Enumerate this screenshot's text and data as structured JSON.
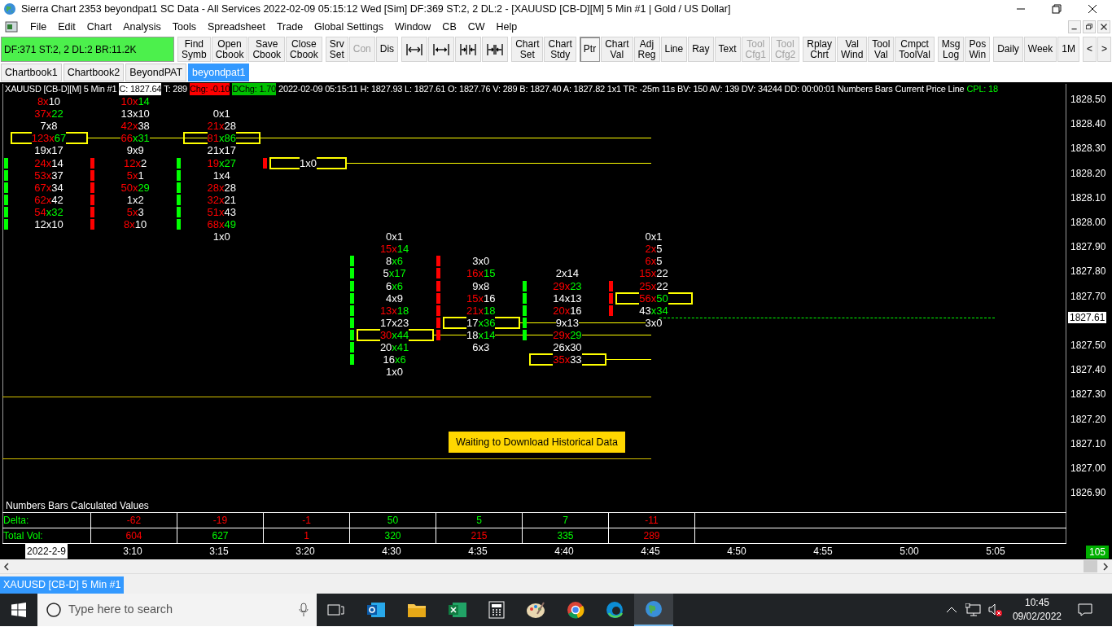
{
  "window": {
    "title": "Sierra Chart 2353 beyondpat1  SC Data - All Services 2022-02-09  05:15:12 Wed [Sim]  DF:369  ST:2, 2  DL:2 - [XAUUSD [CB-D][M]  5 Min   #1 | Gold / US Dollar]"
  },
  "menu": [
    "File",
    "Edit",
    "Chart",
    "Analysis",
    "Tools",
    "Spreadsheet",
    "Trade",
    "Global Settings",
    "Window",
    "CB",
    "CW",
    "Help"
  ],
  "status_box": "DF:371  ST:2, 2  DL:2  BR:11.2K",
  "toolbar": [
    [
      {
        "kind": "text",
        "lines": [
          "Find",
          "Symb"
        ],
        "disabled": false,
        "selected": false
      },
      {
        "kind": "text",
        "lines": [
          "Open",
          "Cbook"
        ],
        "disabled": false,
        "selected": false
      },
      {
        "kind": "text",
        "lines": [
          "Save",
          "Cbook"
        ],
        "disabled": false,
        "selected": false
      },
      {
        "kind": "text",
        "lines": [
          "Close",
          "Cbook"
        ],
        "disabled": false,
        "selected": false
      }
    ],
    [
      {
        "kind": "text",
        "lines": [
          "Srv",
          "Set"
        ],
        "disabled": false,
        "selected": false
      },
      {
        "kind": "text",
        "lines": [
          "Con"
        ],
        "disabled": true,
        "selected": false
      },
      {
        "kind": "text",
        "lines": [
          "Dis"
        ],
        "disabled": false,
        "selected": false
      }
    ],
    [
      {
        "kind": "icon",
        "disabled": false,
        "selected": false
      },
      {
        "kind": "icon",
        "disabled": false,
        "selected": false
      },
      {
        "kind": "icon",
        "disabled": false,
        "selected": false
      },
      {
        "kind": "icon",
        "disabled": false,
        "selected": false
      }
    ],
    [
      {
        "kind": "text",
        "lines": [
          "Chart",
          "Set"
        ],
        "disabled": false,
        "selected": false
      },
      {
        "kind": "text",
        "lines": [
          "Chart",
          "Stdy"
        ],
        "disabled": false,
        "selected": false
      }
    ],
    [
      {
        "kind": "text",
        "lines": [
          "Ptr"
        ],
        "disabled": false,
        "selected": true
      },
      {
        "kind": "text",
        "lines": [
          "Chart",
          "Val"
        ],
        "disabled": false,
        "selected": false
      },
      {
        "kind": "text",
        "lines": [
          "Adj",
          "Reg"
        ],
        "disabled": false,
        "selected": false
      },
      {
        "kind": "text",
        "lines": [
          "Line"
        ],
        "disabled": false,
        "selected": false
      },
      {
        "kind": "text",
        "lines": [
          "Ray"
        ],
        "disabled": false,
        "selected": false
      },
      {
        "kind": "text",
        "lines": [
          "Text"
        ],
        "disabled": false,
        "selected": false
      },
      {
        "kind": "text",
        "lines": [
          "Tool",
          "Cfg1"
        ],
        "disabled": true,
        "selected": false
      },
      {
        "kind": "text",
        "lines": [
          "Tool",
          "Cfg2"
        ],
        "disabled": true,
        "selected": false
      }
    ],
    [
      {
        "kind": "text",
        "lines": [
          "Rplay",
          "Chrt"
        ],
        "disabled": false,
        "selected": false
      },
      {
        "kind": "text",
        "lines": [
          "Val",
          "Wind"
        ],
        "disabled": false,
        "selected": false
      },
      {
        "kind": "text",
        "lines": [
          "Tool",
          "Val"
        ],
        "disabled": false,
        "selected": false
      },
      {
        "kind": "text",
        "lines": [
          "Cmpct",
          "ToolVal"
        ],
        "disabled": false,
        "selected": false
      }
    ],
    [
      {
        "kind": "text",
        "lines": [
          "Msg",
          "Log"
        ],
        "disabled": false,
        "selected": false
      },
      {
        "kind": "text",
        "lines": [
          "Pos",
          "Win"
        ],
        "disabled": false,
        "selected": false
      }
    ],
    [
      {
        "kind": "text",
        "lines": [
          "Daily"
        ],
        "disabled": false,
        "selected": false
      },
      {
        "kind": "text",
        "lines": [
          "Week"
        ],
        "disabled": false,
        "selected": false
      },
      {
        "kind": "text",
        "lines": [
          "1M"
        ],
        "disabled": false,
        "selected": false
      }
    ],
    [
      {
        "kind": "text",
        "lines": [
          "<"
        ],
        "disabled": false,
        "selected": false
      },
      {
        "kind": "text",
        "lines": [
          ">"
        ],
        "disabled": false,
        "selected": false
      }
    ]
  ],
  "chartbook_tabs": [
    {
      "label": "Chartbook1",
      "selected": false
    },
    {
      "label": "Chartbook2",
      "selected": false
    },
    {
      "label": "BeyondPAT",
      "selected": false
    },
    {
      "label": "beyondpat1",
      "selected": true
    }
  ],
  "chart": {
    "header": [
      {
        "text": "XAUUSD [CB-D][M]  5 Min   #1",
        "kind": "plain"
      },
      {
        "text": "C: 1827.64",
        "kind": "inverse"
      },
      {
        "text": "T: 289",
        "kind": "plain"
      },
      {
        "text": "Chg: -0.10",
        "kind": "down"
      },
      {
        "text": "DChg: 1.70",
        "kind": "up"
      },
      {
        "text": "2022-02-09 05:15:11 H: 1827.93 L: 1827.61 O: 1827.76 V: 289 B: 1827.40 A: 1827.82 1x1 TR: -25m 11s BV: 150 AV: 139 DV: 34244 DD: 00:00:01 Numbers Bars  Current Price Line",
        "kind": "plain"
      },
      {
        "text": "CPL: 18",
        "kind": "green_text"
      }
    ],
    "bars": [
      {
        "color": "#00ff00",
        "cells": [
          {
            "kind": "volume",
            "parts": [
              {
                "text": "8x",
                "color": "#ff0000"
              },
              {
                "text": "10",
                "color": "#ffffff"
              }
            ],
            "marked": false,
            "highlighted": false
          },
          {
            "kind": "volume",
            "parts": [
              {
                "text": "37x",
                "color": "#ff0000"
              },
              {
                "text": "22",
                "color": "#00ff00"
              }
            ],
            "marked": false,
            "highlighted": false
          },
          {
            "kind": "volume",
            "parts": [
              {
                "text": "7x8",
                "color": "#ffffff"
              }
            ],
            "marked": false,
            "highlighted": false
          },
          {
            "kind": "volume",
            "parts": [
              {
                "text": "123x",
                "color": "#ff0000"
              },
              {
                "text": "67",
                "color": "#00ff00"
              }
            ],
            "marked": false,
            "highlighted": true
          },
          {
            "kind": "volume",
            "parts": [
              {
                "text": "19x17",
                "color": "#ffffff"
              }
            ],
            "marked": false,
            "highlighted": false
          },
          {
            "kind": "volume",
            "parts": [
              {
                "text": "24x",
                "color": "#ff0000"
              },
              {
                "text": "14",
                "color": "#ffffff"
              }
            ],
            "marked": true,
            "highlighted": false
          },
          {
            "kind": "volume",
            "parts": [
              {
                "text": "53x",
                "color": "#ff0000"
              },
              {
                "text": "37",
                "color": "#ffffff"
              }
            ],
            "marked": true,
            "highlighted": false
          },
          {
            "kind": "volume",
            "parts": [
              {
                "text": "67x",
                "color": "#ff0000"
              },
              {
                "text": "34",
                "color": "#ffffff"
              }
            ],
            "marked": true,
            "highlighted": false
          },
          {
            "kind": "volume",
            "parts": [
              {
                "text": "62x",
                "color": "#ff0000"
              },
              {
                "text": "42",
                "color": "#ffffff"
              }
            ],
            "marked": true,
            "highlighted": false
          },
          {
            "kind": "volume",
            "parts": [
              {
                "text": "54",
                "color": "#ff0000"
              },
              {
                "text": "x32",
                "color": "#00ff00"
              }
            ],
            "marked": true,
            "highlighted": false
          },
          {
            "kind": "volume",
            "parts": [
              {
                "text": "12x10",
                "color": "#ffffff"
              }
            ],
            "marked": true,
            "highlighted": false
          }
        ]
      },
      {
        "color": "#ff0000",
        "cells": [
          {
            "kind": "volume",
            "parts": [
              {
                "text": "10x",
                "color": "#ff0000"
              },
              {
                "text": "14",
                "color": "#00ff00"
              }
            ],
            "marked": false,
            "highlighted": false
          },
          {
            "kind": "volume",
            "parts": [
              {
                "text": "13x10",
                "color": "#ffffff"
              }
            ],
            "marked": false,
            "highlighted": false
          },
          {
            "kind": "volume",
            "parts": [
              {
                "text": "42x",
                "color": "#ff0000"
              },
              {
                "text": "38",
                "color": "#ffffff"
              }
            ],
            "marked": false,
            "highlighted": false
          },
          {
            "kind": "volume",
            "parts": [
              {
                "text": "66",
                "color": "#ff0000"
              },
              {
                "text": "x31",
                "color": "#00ff00"
              }
            ],
            "marked": false,
            "highlighted": false
          },
          {
            "kind": "volume",
            "parts": [
              {
                "text": "9x9",
                "color": "#ffffff"
              }
            ],
            "marked": false,
            "highlighted": false
          },
          {
            "kind": "volume",
            "parts": [
              {
                "text": "12x",
                "color": "#ff0000"
              },
              {
                "text": "2",
                "color": "#ffffff"
              }
            ],
            "marked": true,
            "highlighted": false
          },
          {
            "kind": "volume",
            "parts": [
              {
                "text": "5x",
                "color": "#ff0000"
              },
              {
                "text": "1",
                "color": "#ffffff"
              }
            ],
            "marked": true,
            "highlighted": false
          },
          {
            "kind": "volume",
            "parts": [
              {
                "text": "50x",
                "color": "#ff0000"
              },
              {
                "text": "29",
                "color": "#00ff00"
              }
            ],
            "marked": true,
            "highlighted": false
          },
          {
            "kind": "volume",
            "parts": [
              {
                "text": "1x2",
                "color": "#ffffff"
              }
            ],
            "marked": true,
            "highlighted": false
          },
          {
            "kind": "volume",
            "parts": [
              {
                "text": "5x",
                "color": "#ff0000"
              },
              {
                "text": "3",
                "color": "#ffffff"
              }
            ],
            "marked": true,
            "highlighted": false
          },
          {
            "kind": "volume",
            "parts": [
              {
                "text": "8x",
                "color": "#ff0000"
              },
              {
                "text": "10",
                "color": "#ffffff"
              }
            ],
            "marked": true,
            "highlighted": false
          }
        ]
      },
      {
        "color": "#00ff00",
        "cells": [
          {
            "kind": "gap"
          },
          {
            "kind": "volume",
            "parts": [
              {
                "text": "0x1",
                "color": "#ffffff"
              }
            ],
            "marked": false,
            "highlighted": false
          },
          {
            "kind": "volume",
            "parts": [
              {
                "text": "21x",
                "color": "#ff0000"
              },
              {
                "text": "28",
                "color": "#ffffff"
              }
            ],
            "marked": false,
            "highlighted": false
          },
          {
            "kind": "volume",
            "parts": [
              {
                "text": "81",
                "color": "#ff0000"
              },
              {
                "text": "x86",
                "color": "#00ff00"
              }
            ],
            "marked": false,
            "highlighted": true
          },
          {
            "kind": "volume",
            "parts": [
              {
                "text": "21x17",
                "color": "#ffffff"
              }
            ],
            "marked": false,
            "highlighted": false
          },
          {
            "kind": "volume",
            "parts": [
              {
                "text": "19",
                "color": "#ff0000"
              },
              {
                "text": "x27",
                "color": "#00ff00"
              }
            ],
            "marked": true,
            "highlighted": false
          },
          {
            "kind": "volume",
            "parts": [
              {
                "text": "1x4",
                "color": "#ffffff"
              }
            ],
            "marked": true,
            "highlighted": false
          },
          {
            "kind": "volume",
            "parts": [
              {
                "text": "28x",
                "color": "#ff0000"
              },
              {
                "text": "28",
                "color": "#ffffff"
              }
            ],
            "marked": true,
            "highlighted": false
          },
          {
            "kind": "volume",
            "parts": [
              {
                "text": "32x",
                "color": "#ff0000"
              },
              {
                "text": "21",
                "color": "#ffffff"
              }
            ],
            "marked": true,
            "highlighted": false
          },
          {
            "kind": "volume",
            "parts": [
              {
                "text": "51x",
                "color": "#ff0000"
              },
              {
                "text": "43",
                "color": "#ffffff"
              }
            ],
            "marked": true,
            "highlighted": false
          },
          {
            "kind": "volume",
            "parts": [
              {
                "text": "68x",
                "color": "#ff0000"
              },
              {
                "text": "49",
                "color": "#00ff00"
              }
            ],
            "marked": true,
            "highlighted": false
          },
          {
            "kind": "volume",
            "parts": [
              {
                "text": "1x0",
                "color": "#ffffff"
              }
            ],
            "marked": false,
            "highlighted": false
          }
        ]
      },
      {
        "color": "#ff0000",
        "cells": [
          {
            "kind": "gap"
          },
          {
            "kind": "gap"
          },
          {
            "kind": "gap"
          },
          {
            "kind": "gap"
          },
          {
            "kind": "gap"
          },
          {
            "kind": "volume",
            "parts": [
              {
                "text": "1x0",
                "color": "#ffffff"
              }
            ],
            "marked": true,
            "highlighted": true
          }
        ]
      },
      {
        "color": "#00ff00",
        "cells": [
          {
            "kind": "gap"
          },
          {
            "kind": "gap"
          },
          {
            "kind": "gap"
          },
          {
            "kind": "gap"
          },
          {
            "kind": "gap"
          },
          {
            "kind": "gap"
          },
          {
            "kind": "gap"
          },
          {
            "kind": "gap"
          },
          {
            "kind": "gap"
          },
          {
            "kind": "gap"
          },
          {
            "kind": "gap"
          },
          {
            "kind": "volume",
            "parts": [
              {
                "text": "0x1",
                "color": "#ffffff"
              }
            ],
            "marked": false,
            "highlighted": false
          },
          {
            "kind": "volume",
            "parts": [
              {
                "text": "15x",
                "color": "#ff0000"
              },
              {
                "text": "14",
                "color": "#00ff00"
              }
            ],
            "marked": false,
            "highlighted": false
          },
          {
            "kind": "volume",
            "parts": [
              {
                "text": "8",
                "color": "#ffffff"
              },
              {
                "text": "x6",
                "color": "#00ff00"
              }
            ],
            "marked": true,
            "highlighted": false
          },
          {
            "kind": "volume",
            "parts": [
              {
                "text": "5",
                "color": "#ffffff"
              },
              {
                "text": "x17",
                "color": "#00ff00"
              }
            ],
            "marked": true,
            "highlighted": false
          },
          {
            "kind": "volume",
            "parts": [
              {
                "text": "6",
                "color": "#ffffff"
              },
              {
                "text": "x6",
                "color": "#00ff00"
              }
            ],
            "marked": true,
            "highlighted": false
          },
          {
            "kind": "volume",
            "parts": [
              {
                "text": "4x9",
                "color": "#ffffff"
              }
            ],
            "marked": true,
            "highlighted": false
          },
          {
            "kind": "volume",
            "parts": [
              {
                "text": "13x",
                "color": "#ff0000"
              },
              {
                "text": "18",
                "color": "#00ff00"
              }
            ],
            "marked": true,
            "highlighted": false
          },
          {
            "kind": "volume",
            "parts": [
              {
                "text": "17x23",
                "color": "#ffffff"
              }
            ],
            "marked": true,
            "highlighted": false
          },
          {
            "kind": "volume",
            "parts": [
              {
                "text": "30",
                "color": "#ff0000"
              },
              {
                "text": "x44",
                "color": "#00ff00"
              }
            ],
            "marked": true,
            "highlighted": true
          },
          {
            "kind": "volume",
            "parts": [
              {
                "text": "20",
                "color": "#ffffff"
              },
              {
                "text": "x41",
                "color": "#00ff00"
              }
            ],
            "marked": true,
            "highlighted": false
          },
          {
            "kind": "volume",
            "parts": [
              {
                "text": "16",
                "color": "#ffffff"
              },
              {
                "text": "x6",
                "color": "#00ff00"
              }
            ],
            "marked": true,
            "highlighted": false
          },
          {
            "kind": "volume",
            "parts": [
              {
                "text": "1x0",
                "color": "#ffffff"
              }
            ],
            "marked": false,
            "highlighted": false
          }
        ]
      },
      {
        "color": "#ff0000",
        "cells": [
          {
            "kind": "gap"
          },
          {
            "kind": "gap"
          },
          {
            "kind": "gap"
          },
          {
            "kind": "gap"
          },
          {
            "kind": "gap"
          },
          {
            "kind": "gap"
          },
          {
            "kind": "gap"
          },
          {
            "kind": "gap"
          },
          {
            "kind": "gap"
          },
          {
            "kind": "gap"
          },
          {
            "kind": "gap"
          },
          {
            "kind": "gap"
          },
          {
            "kind": "gap"
          },
          {
            "kind": "volume",
            "parts": [
              {
                "text": "3x0",
                "color": "#ffffff"
              }
            ],
            "marked": true,
            "highlighted": false
          },
          {
            "kind": "volume",
            "parts": [
              {
                "text": "16x",
                "color": "#ff0000"
              },
              {
                "text": "15",
                "color": "#00ff00"
              }
            ],
            "marked": true,
            "highlighted": false
          },
          {
            "kind": "volume",
            "parts": [
              {
                "text": "9x8",
                "color": "#ffffff"
              }
            ],
            "marked": true,
            "highlighted": false
          },
          {
            "kind": "volume",
            "parts": [
              {
                "text": "15x",
                "color": "#ff0000"
              },
              {
                "text": "16",
                "color": "#ffffff"
              }
            ],
            "marked": true,
            "highlighted": false
          },
          {
            "kind": "volume",
            "parts": [
              {
                "text": "21x",
                "color": "#ff0000"
              },
              {
                "text": "18",
                "color": "#00ff00"
              }
            ],
            "marked": true,
            "highlighted": false
          },
          {
            "kind": "volume",
            "parts": [
              {
                "text": "17",
                "color": "#ffffff"
              },
              {
                "text": "x36",
                "color": "#00ff00"
              }
            ],
            "marked": true,
            "highlighted": true
          },
          {
            "kind": "volume",
            "parts": [
              {
                "text": "18",
                "color": "#ffffff"
              },
              {
                "text": "x14",
                "color": "#00ff00"
              }
            ],
            "marked": true,
            "highlighted": false
          },
          {
            "kind": "volume",
            "parts": [
              {
                "text": "6x3",
                "color": "#ffffff"
              }
            ],
            "marked": false,
            "highlighted": false
          }
        ]
      },
      {
        "color": "#00ff00",
        "cells": [
          {
            "kind": "gap"
          },
          {
            "kind": "gap"
          },
          {
            "kind": "gap"
          },
          {
            "kind": "gap"
          },
          {
            "kind": "gap"
          },
          {
            "kind": "gap"
          },
          {
            "kind": "gap"
          },
          {
            "kind": "gap"
          },
          {
            "kind": "gap"
          },
          {
            "kind": "gap"
          },
          {
            "kind": "gap"
          },
          {
            "kind": "gap"
          },
          {
            "kind": "gap"
          },
          {
            "kind": "gap"
          },
          {
            "kind": "volume",
            "parts": [
              {
                "text": "2x14",
                "color": "#ffffff"
              }
            ],
            "marked": false,
            "highlighted": false
          },
          {
            "kind": "volume",
            "parts": [
              {
                "text": "29x",
                "color": "#ff0000"
              },
              {
                "text": "23",
                "color": "#00ff00"
              }
            ],
            "marked": true,
            "highlighted": false
          },
          {
            "kind": "volume",
            "parts": [
              {
                "text": "14x13",
                "color": "#ffffff"
              }
            ],
            "marked": true,
            "highlighted": false
          },
          {
            "kind": "volume",
            "parts": [
              {
                "text": "20x",
                "color": "#ff0000"
              },
              {
                "text": "16",
                "color": "#ffffff"
              }
            ],
            "marked": true,
            "highlighted": false
          },
          {
            "kind": "volume",
            "parts": [
              {
                "text": "9x13",
                "color": "#ffffff"
              }
            ],
            "marked": true,
            "highlighted": false
          },
          {
            "kind": "volume",
            "parts": [
              {
                "text": "29x",
                "color": "#ff0000"
              },
              {
                "text": "29",
                "color": "#00ff00"
              }
            ],
            "marked": true,
            "highlighted": false
          },
          {
            "kind": "volume",
            "parts": [
              {
                "text": "26x30",
                "color": "#ffffff"
              }
            ],
            "marked": false,
            "highlighted": false
          },
          {
            "kind": "volume",
            "parts": [
              {
                "text": "35x",
                "color": "#ff0000"
              },
              {
                "text": "33",
                "color": "#ffffff"
              }
            ],
            "marked": false,
            "highlighted": true
          }
        ]
      },
      {
        "color": "#ff0000",
        "cells": [
          {
            "kind": "gap"
          },
          {
            "kind": "gap"
          },
          {
            "kind": "gap"
          },
          {
            "kind": "gap"
          },
          {
            "kind": "gap"
          },
          {
            "kind": "gap"
          },
          {
            "kind": "gap"
          },
          {
            "kind": "gap"
          },
          {
            "kind": "gap"
          },
          {
            "kind": "gap"
          },
          {
            "kind": "gap"
          },
          {
            "kind": "volume",
            "parts": [
              {
                "text": "0x1",
                "color": "#ffffff"
              }
            ],
            "marked": false,
            "highlighted": false
          },
          {
            "kind": "volume",
            "parts": [
              {
                "text": "2x",
                "color": "#ff0000"
              },
              {
                "text": "5",
                "color": "#ffffff"
              }
            ],
            "marked": false,
            "highlighted": false
          },
          {
            "kind": "volume",
            "parts": [
              {
                "text": "6x",
                "color": "#ff0000"
              },
              {
                "text": "5",
                "color": "#ffffff"
              }
            ],
            "marked": false,
            "highlighted": false
          },
          {
            "kind": "volume",
            "parts": [
              {
                "text": "15x",
                "color": "#ff0000"
              },
              {
                "text": "22",
                "color": "#ffffff"
              }
            ],
            "marked": false,
            "highlighted": false
          },
          {
            "kind": "volume",
            "parts": [
              {
                "text": "25x",
                "color": "#ff0000"
              },
              {
                "text": "22",
                "color": "#ffffff"
              }
            ],
            "marked": true,
            "highlighted": false
          },
          {
            "kind": "volume",
            "parts": [
              {
                "text": "56x",
                "color": "#ff0000"
              },
              {
                "text": "50",
                "color": "#00ff00"
              }
            ],
            "marked": true,
            "highlighted": true
          },
          {
            "kind": "volume",
            "parts": [
              {
                "text": "43",
                "color": "#ffffff"
              },
              {
                "text": "x34",
                "color": "#00ff00"
              }
            ],
            "marked": true,
            "highlighted": false
          },
          {
            "kind": "volume",
            "parts": [
              {
                "text": "3x0",
                "color": "#ffffff"
              }
            ],
            "marked": false,
            "highlighted": false
          }
        ]
      }
    ],
    "current_price": "1827.61",
    "notice": "Waiting to Download Historical Data",
    "price_axis": [
      "1828.50",
      "1828.40",
      "1828.30",
      "1828.20",
      "1828.10",
      "1828.00",
      "1827.90",
      "1827.80",
      "1827.70",
      "1827.50",
      "1827.40",
      "1827.30",
      "1827.20",
      "1827.10",
      "1827.00",
      "1826.90"
    ],
    "values_title": "Numbers Bars Calculated Values",
    "values_rows": [
      {
        "label": "Delta:",
        "values": [
          {
            "text": "-62",
            "color": "#ff0000"
          },
          {
            "text": "-19",
            "color": "#ff0000"
          },
          {
            "text": "-1",
            "color": "#ff0000"
          },
          {
            "text": "50",
            "color": "#00ff00"
          },
          {
            "text": "5",
            "color": "#00ff00"
          },
          {
            "text": "7",
            "color": "#00ff00"
          },
          {
            "text": "-11",
            "color": "#ff0000"
          }
        ]
      },
      {
        "label": "Total Vol:",
        "values": [
          {
            "text": "604",
            "color": "#ff0000"
          },
          {
            "text": "627",
            "color": "#00ff00"
          },
          {
            "text": "1",
            "color": "#ff0000"
          },
          {
            "text": "320",
            "color": "#00ff00"
          },
          {
            "text": "215",
            "color": "#ff0000"
          },
          {
            "text": "335",
            "color": "#00ff00"
          },
          {
            "text": "289",
            "color": "#ff0000"
          }
        ]
      }
    ],
    "time_axis": [
      {
        "text": "2022-2-9",
        "kind": "date"
      },
      {
        "text": "3:10",
        "kind": "time"
      },
      {
        "text": "3:15",
        "kind": "time"
      },
      {
        "text": "3:20",
        "kind": "time"
      },
      {
        "text": "4:30",
        "kind": "time"
      },
      {
        "text": "4:35",
        "kind": "time"
      },
      {
        "text": "4:40",
        "kind": "time"
      },
      {
        "text": "4:45",
        "kind": "time"
      },
      {
        "text": "4:50",
        "kind": "time"
      },
      {
        "text": "4:55",
        "kind": "time"
      },
      {
        "text": "5:00",
        "kind": "time"
      },
      {
        "text": "5:05",
        "kind": "time"
      }
    ],
    "bar_count": "105"
  },
  "chart_tab": {
    "label": "XAUUSD [CB-D]  5 Min   #1",
    "selected": true
  },
  "taskbar": {
    "search_placeholder": "Type here to search",
    "time": "10:45",
    "date": "09/02/2022"
  }
}
